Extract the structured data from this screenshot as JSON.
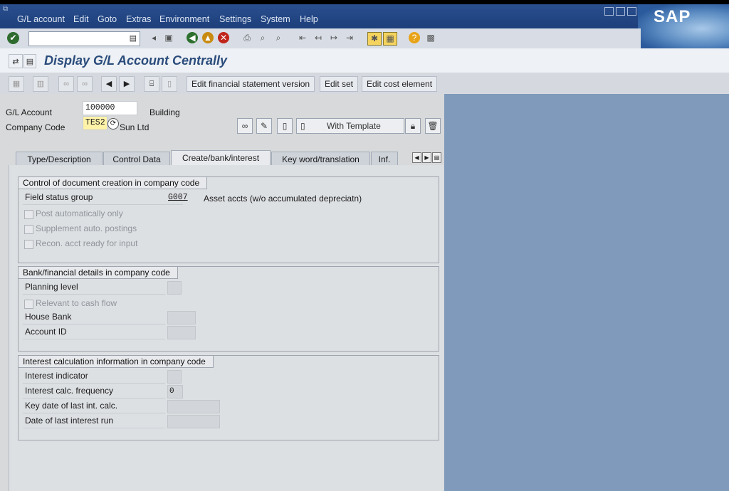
{
  "menu": [
    "G/L account",
    "Edit",
    "Goto",
    "Extras",
    "Environment",
    "Settings",
    "System",
    "Help"
  ],
  "brand": "SAP",
  "title": "Display G/L Account Centrally",
  "app_toolbar": {
    "edit_fs_version": "Edit financial statement version",
    "edit_set": "Edit set",
    "edit_cost_element": "Edit cost element"
  },
  "header": {
    "gl_account_label": "G/L Account",
    "gl_account_value": "100000",
    "gl_account_desc": "Building",
    "company_code_label": "Company Code",
    "company_code_value": "TES2",
    "company_code_desc": "Sun Ltd",
    "with_template": "With Template"
  },
  "tabs": [
    "Type/Description",
    "Control Data",
    "Create/bank/interest",
    "Key word/translation",
    "Inf."
  ],
  "active_tab": "Create/bank/interest",
  "group1": {
    "title": "Control of document creation in company code",
    "field_status_group_label": "Field status group",
    "field_status_group_value": "G007",
    "field_status_group_desc": "Asset accts (w/o accumulated depreciatn)",
    "post_auto": "Post automatically only",
    "supplement_auto": "Supplement auto. postings",
    "recon_acct": "Recon. acct ready for input"
  },
  "group2": {
    "title": "Bank/financial details in company code",
    "planning_level": "Planning level",
    "relevant_cash_flow": "Relevant to cash flow",
    "house_bank": "House Bank",
    "account_id": "Account ID"
  },
  "group3": {
    "title": "Interest calculation information in company code",
    "interest_indicator": "Interest indicator",
    "interest_calc_freq": "Interest calc. frequency",
    "interest_calc_freq_value": "0",
    "key_date_last": "Key date of last int. calc.",
    "date_last_run": "Date of last interest run"
  },
  "colors": {
    "menubar": "#1d3f7a",
    "title": "#2a4c7c",
    "panel": "#dde0e3",
    "right_bg": "#7f9aba"
  }
}
